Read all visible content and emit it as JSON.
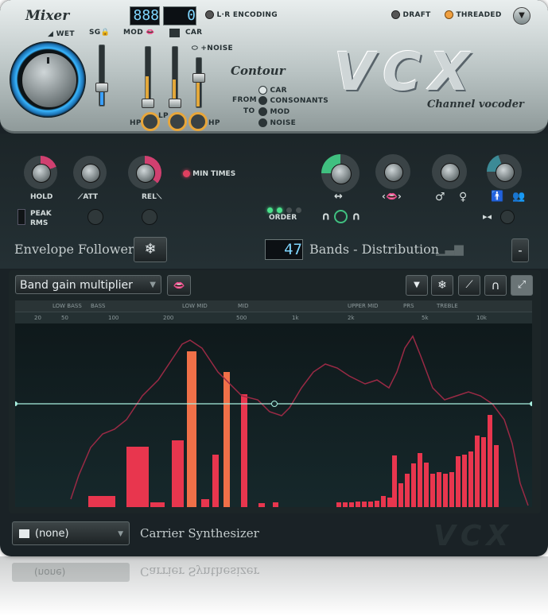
{
  "mixer": {
    "title": "Mixer",
    "wet_label": "WET",
    "sg_label": "SG",
    "mod_label": "MOD",
    "car_label": "CAR",
    "noise_label": "+NOISE",
    "hp_label": "HP",
    "lp_label": "LP",
    "hp2_label": "HP",
    "display_left": "888",
    "display_right": "0",
    "lr_encoding": "L·R ENCODING"
  },
  "flags": {
    "draft": "DRAFT",
    "threaded": "THREADED"
  },
  "contour": {
    "title": "Contour",
    "from_label": "FROM",
    "to_label": "TO",
    "options": [
      "CAR",
      "CONSONANTS",
      "MOD",
      "NOISE"
    ]
  },
  "logo": {
    "text": "VCX",
    "subtitle": "Channel vocoder"
  },
  "envelope": {
    "hold_label": "HOLD",
    "att_label": "ATT",
    "rel_label": "REL",
    "min_times_label": "MIN TIMES",
    "peak_label": "PEAK",
    "rms_label": "RMS",
    "order_label": "ORDER",
    "section_title": "Envelope Follower",
    "order_level": 2
  },
  "bands": {
    "count": "47",
    "title": "Bands - Distribution",
    "minus_label": "-"
  },
  "graph": {
    "mode": "Band gain multiplier",
    "ruler_top": [
      "LOW BASS",
      "BASS",
      "LOW MID",
      "MID",
      "UPPER MID",
      "PRS",
      "TREBLE"
    ],
    "ruler_bottom": [
      "20",
      "50",
      "100",
      "200",
      "500",
      "1k",
      "2k",
      "5k",
      "10k"
    ]
  },
  "carrier": {
    "selector_value": "(none)",
    "title": "Carrier Synthesizer"
  },
  "icons": {
    "menu": "menu-icon",
    "snowflake": "snowflake-icon",
    "lips": "lips-icon",
    "keyboard": "keyboard-icon",
    "male": "male-icon",
    "female": "female-icon",
    "person": "person-icon",
    "people": "people-icon"
  },
  "colors": {
    "accent": "#e8a63a",
    "bar": "#e8364e",
    "bar_hot": "#f07048",
    "line": "#a8f0e0",
    "curve": "#9a2a45"
  },
  "reflection": {
    "selector_value": "(none)",
    "title": "Carrier Synthesizer"
  }
}
